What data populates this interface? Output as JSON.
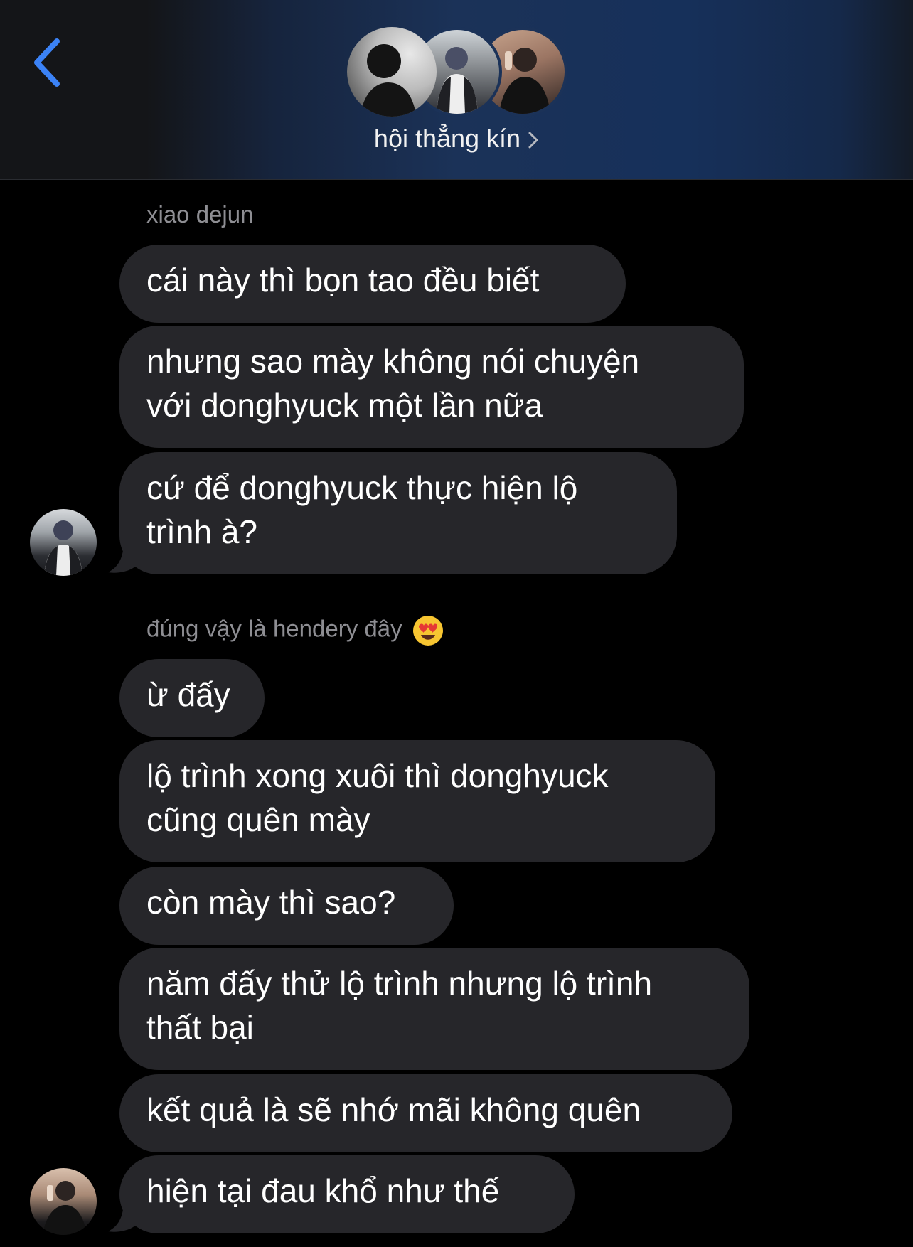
{
  "header": {
    "group_name": "hội thẳng kín",
    "back_icon": "chevron-left-icon",
    "accent_color": "#3b82f6"
  },
  "messages": {
    "group1": {
      "sender": "xiao dejun",
      "bubbles": [
        {
          "line1": "cái này thì bọn tao đều biết"
        },
        {
          "line1": "nhưng sao mày không nói chuyện",
          "line2": "với donghyuck một lần nữa"
        },
        {
          "line1": "cứ để donghyuck thực hiện lộ",
          "line2": "trình à?"
        }
      ]
    },
    "group2": {
      "sender": "đúng vậy là hendery đây",
      "sender_emoji": "heart-eyes-emoji-icon",
      "bubbles": [
        {
          "line1": "ừ đấy"
        },
        {
          "line1": "lộ trình xong xuôi thì donghyuck",
          "line2": "cũng quên mày"
        },
        {
          "line1": "còn mày thì sao?"
        },
        {
          "line1": "năm đấy thử lộ trình nhưng lộ trình",
          "line2": "thất bại"
        },
        {
          "line1": "kết quả là sẽ nhớ mãi không quên"
        },
        {
          "line1": "hiện tại đau khổ như thế"
        }
      ]
    }
  },
  "colors": {
    "background": "#000000",
    "bubble": "#26262a",
    "sender_text": "#8e8e93",
    "header_blue": "#1b3258"
  }
}
